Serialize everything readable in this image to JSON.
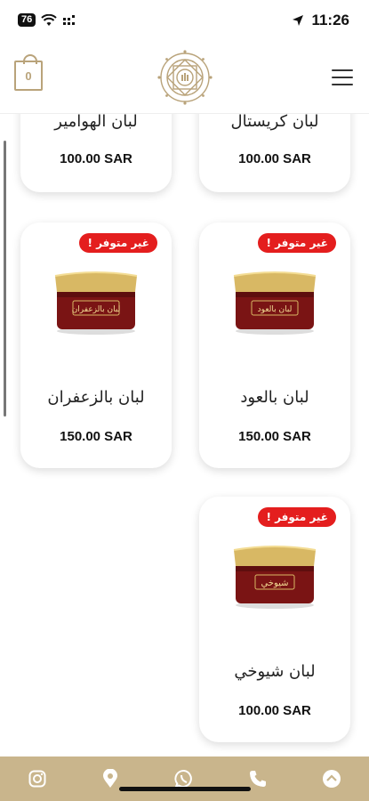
{
  "status_bar": {
    "battery": "76",
    "time": "11:26"
  },
  "header": {
    "cart_count": "0"
  },
  "products": [
    {
      "name": "لبان الهوامير",
      "price": "100.00 SAR",
      "badge": ""
    },
    {
      "name": "لبان كريستال",
      "price": "100.00 SAR",
      "badge": ""
    },
    {
      "name": "لبان بالزعفران",
      "price": "150.00 SAR",
      "badge": "غير متوفر !",
      "jar_label": "لبان بالزعفران"
    },
    {
      "name": "لبان بالعود",
      "price": "150.00 SAR",
      "badge": "غير متوفر !",
      "jar_label": "لبان بالعود"
    },
    {
      "name": "لبان شيوخي",
      "price": "100.00 SAR",
      "badge": "غير متوفر !",
      "jar_label": "شيوخي"
    }
  ],
  "bottom_bar": {
    "icons": [
      "instagram-icon",
      "location-pin-icon",
      "whatsapp-icon",
      "phone-icon",
      "scroll-top-icon"
    ]
  },
  "colors": {
    "gold": "#b9a37a",
    "badge_red": "#e41e1e",
    "bottom_bar": "#c9b58c",
    "jar_lid": "#d8b864",
    "jar_body": "#7a1414"
  }
}
